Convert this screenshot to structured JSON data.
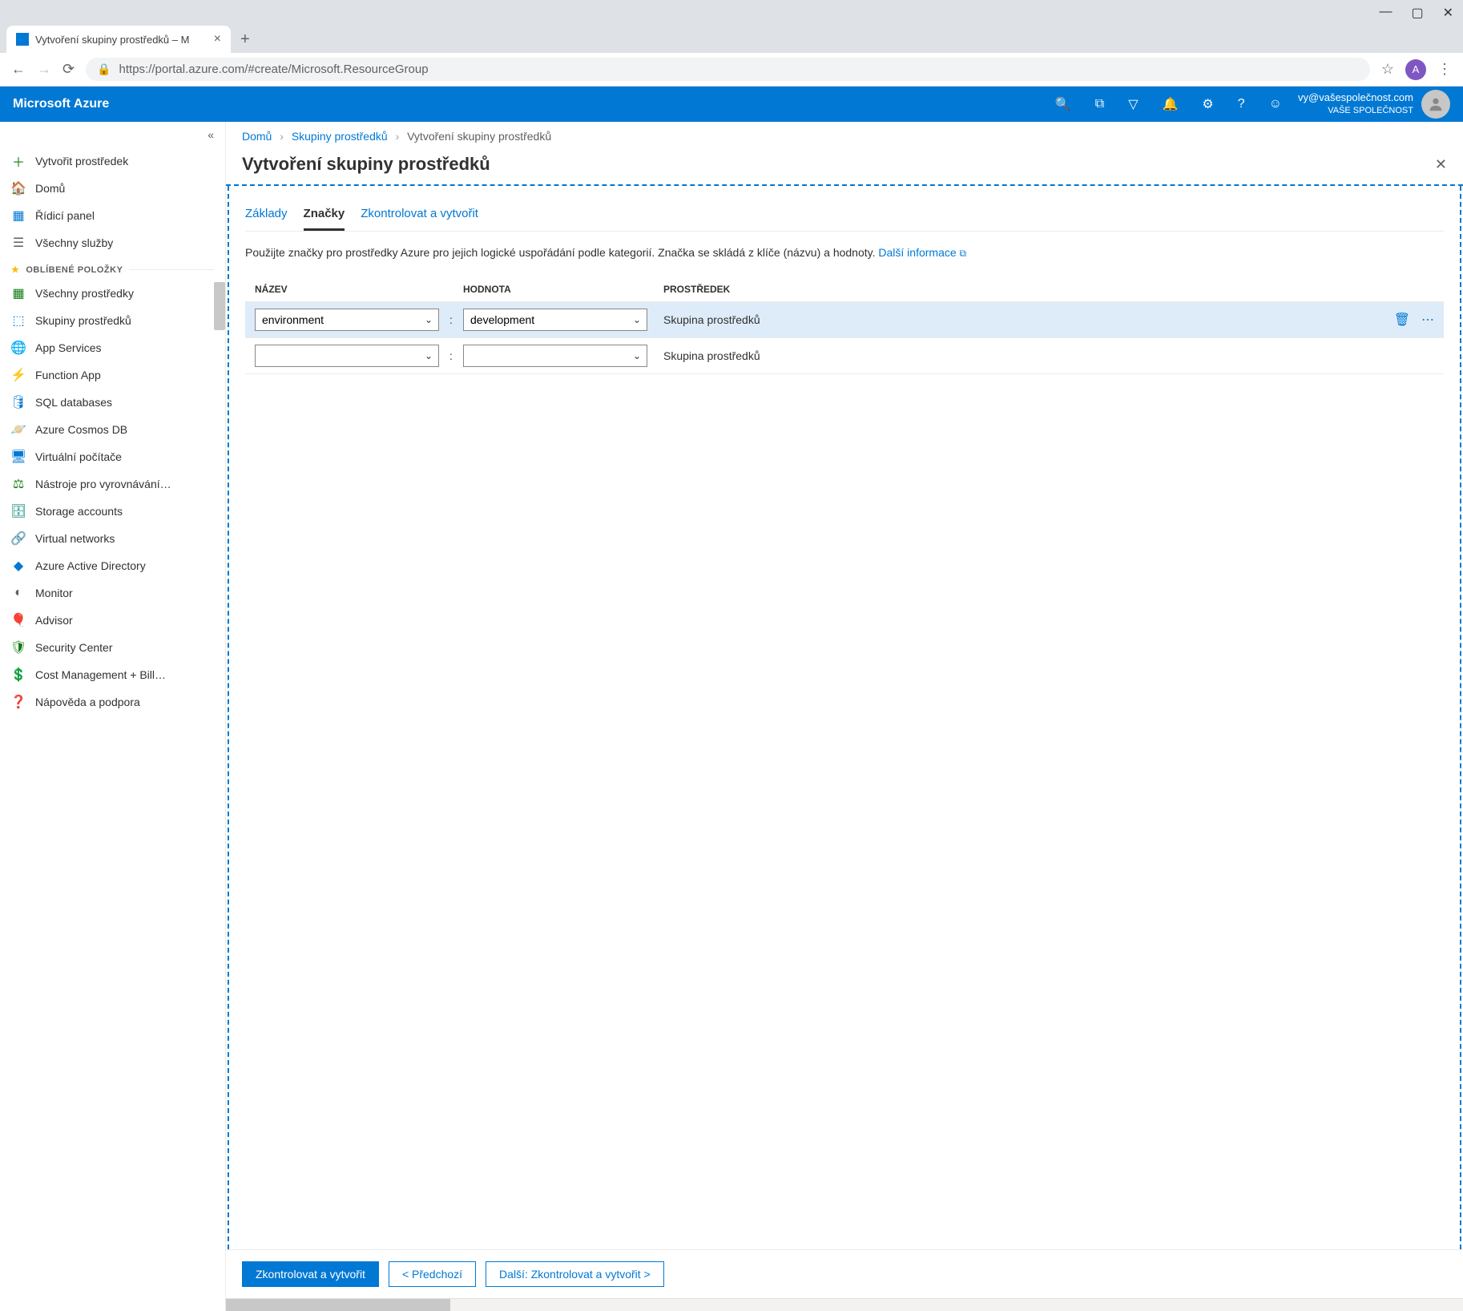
{
  "browser": {
    "tab_title": "Vytvoření skupiny prostředků – M",
    "url": "https://portal.azure.com/#create/Microsoft.ResourceGroup",
    "avatar_letter": "A"
  },
  "header": {
    "brand": "Microsoft Azure",
    "account_email": "vy@vašespolečnost.com",
    "account_company": "VAŠE SPOLEČNOST"
  },
  "sidebar": {
    "create": "Vytvořit prostředek",
    "home": "Domů",
    "dashboard": "Řídicí panel",
    "all_services": "Všechny služby",
    "favorites_header": "OBLÍBENÉ POLOŽKY",
    "items": [
      "Všechny prostředky",
      "Skupiny prostředků",
      "App Services",
      "Function App",
      "SQL databases",
      "Azure Cosmos DB",
      "Virtuální počítače",
      "Nástroje pro vyrovnávání…",
      "Storage accounts",
      "Virtual networks",
      "Azure Active Directory",
      "Monitor",
      "Advisor",
      "Security Center",
      "Cost Management + Bill…",
      "Nápověda a podpora"
    ]
  },
  "breadcrumb": {
    "home": "Domů",
    "groups": "Skupiny prostředků",
    "current": "Vytvoření skupiny prostředků"
  },
  "blade": {
    "title": "Vytvoření skupiny prostředků",
    "tabs": {
      "basics": "Základy",
      "tags": "Značky",
      "review": "Zkontrolovat a vytvořit"
    },
    "description": "Použijte značky pro prostředky Azure pro jejich logické uspořádání podle kategorií. Značka se skládá z klíče (názvu) a hodnoty.",
    "more_info": "Další informace",
    "table": {
      "col_name": "NÁZEV",
      "col_value": "HODNOTA",
      "col_resource": "PROSTŘEDEK",
      "rows": [
        {
          "name": "environment",
          "value": "development",
          "resource": "Skupina prostředků"
        },
        {
          "name": "",
          "value": "",
          "resource": "Skupina prostředků"
        }
      ]
    },
    "footer": {
      "review": "Zkontrolovat a vytvořit",
      "prev": "< Předchozí",
      "next": "Další: Zkontrolovat a vytvořit >"
    }
  }
}
